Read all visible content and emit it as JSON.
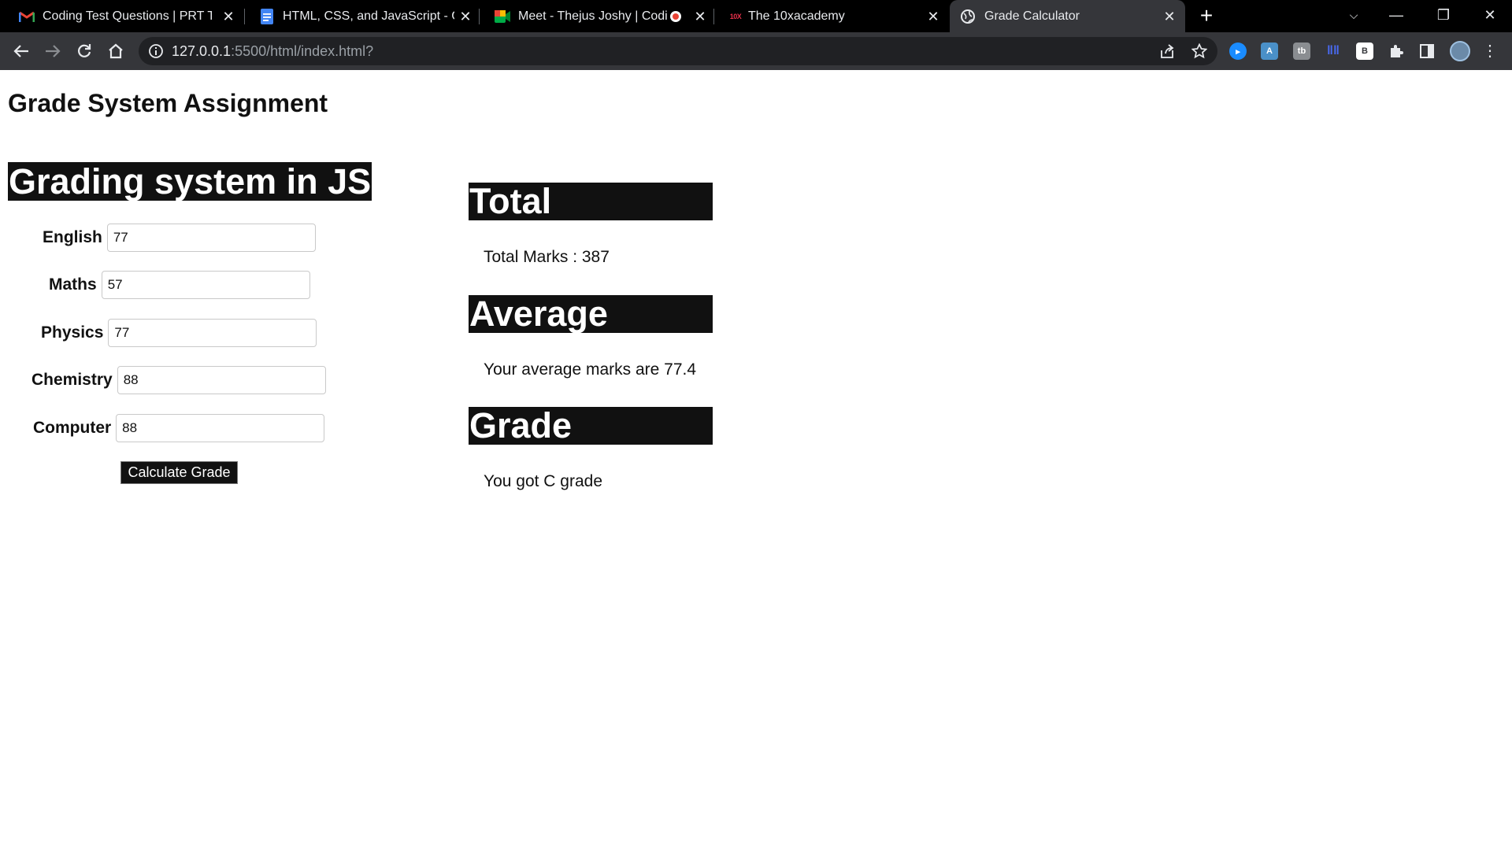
{
  "browser": {
    "tabs": [
      {
        "title": "Coding Test Questions | PRT Test",
        "icon": "gmail-icon"
      },
      {
        "title": "HTML, CSS, and JavaScript - GRA",
        "icon": "docs-icon"
      },
      {
        "title": "Meet - Thejus Joshy | Coding",
        "icon": "meet-icon"
      },
      {
        "title": "The 10xacademy",
        "icon": "10x-icon"
      },
      {
        "title": "Grade Calculator",
        "icon": "globe-icon"
      }
    ],
    "url_host": "127.0.0.1",
    "url_path": ":5500/html/index.html?"
  },
  "page": {
    "title": "Grade System Assignment",
    "form_heading": "Grading system in JS",
    "fields": [
      {
        "label": "English",
        "value": "77"
      },
      {
        "label": "Maths",
        "value": "57"
      },
      {
        "label": "Physics",
        "value": "77"
      },
      {
        "label": "Chemistry",
        "value": "88"
      },
      {
        "label": "Computer",
        "value": "88"
      }
    ],
    "button_label": "Calculate Grade",
    "total": {
      "heading": "Total",
      "text": "Total Marks : 387"
    },
    "average": {
      "heading": "Average",
      "text": "Your average marks are 77.4"
    },
    "grade": {
      "heading": "Grade",
      "text": "You got C grade"
    }
  }
}
